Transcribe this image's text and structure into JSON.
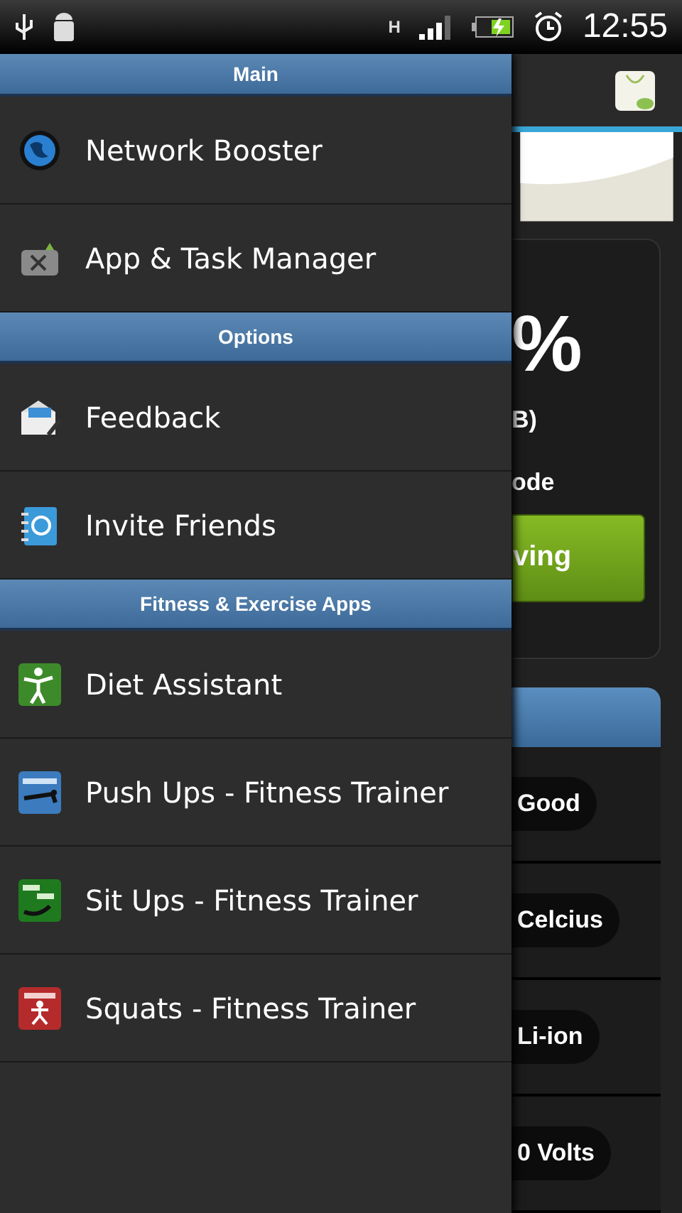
{
  "status_bar": {
    "time": "12:55",
    "network_type": "H"
  },
  "drawer": {
    "sections": [
      {
        "title": "Main",
        "items": [
          {
            "label": "Network Booster"
          },
          {
            "label": "App & Task Manager"
          }
        ]
      },
      {
        "title": "Options",
        "items": [
          {
            "label": "Feedback"
          },
          {
            "label": "Invite Friends"
          }
        ]
      },
      {
        "title": "Fitness & Exercise Apps",
        "items": [
          {
            "label": "Diet Assistant"
          },
          {
            "label": "Push Ups - Fitness Trainer"
          },
          {
            "label": "Sit Ups - Fitness Trainer"
          },
          {
            "label": "Squats - Fitness Trainer"
          }
        ]
      }
    ]
  },
  "background_app": {
    "percent": "%",
    "memory": "B)",
    "mode": "ode",
    "button": "ving",
    "details": [
      {
        "value": "Good"
      },
      {
        "value": "Celcius"
      },
      {
        "value": "Li-ion"
      },
      {
        "value": "0 Volts"
      }
    ]
  }
}
